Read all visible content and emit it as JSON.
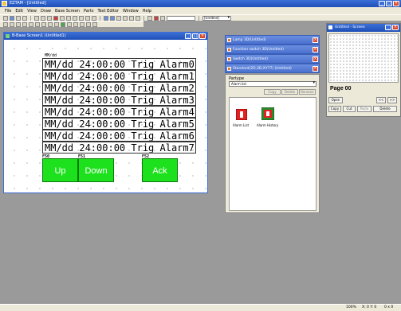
{
  "app": {
    "title": "EZTAM - [Untitled]"
  },
  "menu": [
    "File",
    "Edit",
    "View",
    "Draw",
    "Base Screen",
    "Parts",
    "Text Editor",
    "Window",
    "Help"
  ],
  "toolbar": {
    "input_value": "",
    "select_value": "[Untitled]"
  },
  "screen_window": {
    "title": "B-Base Screen1 (Untitled1)",
    "alarm_label": "MM/dd",
    "alarm_rows": [
      "MM/dd 24:00:00 Trig Alarm0",
      "MM/dd 24:00:00 Trig Alarm1",
      "MM/dd 24:00:00 Trig Alarm2",
      "MM/dd 24:00:00 Trig Alarm3",
      "MM/dd 24:00:00 Trig Alarm4",
      "MM/dd 24:00:00 Trig Alarm5",
      "MM/dd 24:00:00 Trig Alarm6",
      "MM/dd 24:00:00 Trig Alarm7"
    ],
    "fkeys": [
      {
        "label": "F50",
        "text": "Up"
      },
      {
        "label": "F51",
        "text": "Down"
      },
      {
        "label": "F52",
        "text": "Ack"
      }
    ],
    "fkey_color": "#1ee11e"
  },
  "libraries": [
    "Lamp 3D(Untitled)",
    "Function switch 3D(Untitled)",
    "Switch 3D(Untitled)",
    "Standard(2D,3D,XY77) (Untitled)"
  ],
  "parts": {
    "label": "Partype",
    "select_value": "Alarm list",
    "buttons": [
      "Copy",
      "Delete",
      "Rename"
    ],
    "items": [
      "Alarm List",
      "Alarm History"
    ]
  },
  "grid_window": {
    "title": "Untitled - Screen",
    "page_label": "Page 00",
    "buttons": [
      "Open",
      "Copy",
      "Cut",
      "Paste",
      "Delete"
    ],
    "nav": [
      "<<",
      ">>"
    ]
  },
  "status": {
    "zoom": "100%",
    "coords": "X: 0  Y: 0",
    "size": "0 x 0"
  }
}
